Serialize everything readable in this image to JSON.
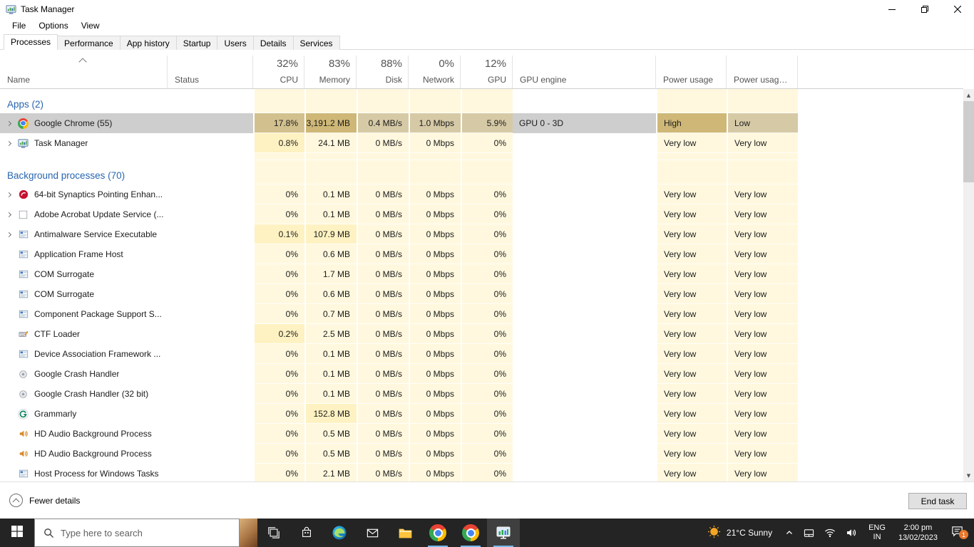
{
  "titlebar": {
    "title": "Task Manager"
  },
  "menubar": {
    "items": [
      "File",
      "Options",
      "View"
    ]
  },
  "tabs": {
    "items": [
      "Processes",
      "Performance",
      "App history",
      "Startup",
      "Users",
      "Details",
      "Services"
    ],
    "selected": "Processes"
  },
  "header": {
    "columns": [
      {
        "id": "name",
        "label": "Name",
        "pct": ""
      },
      {
        "id": "status",
        "label": "Status",
        "pct": ""
      },
      {
        "id": "cpu",
        "label": "CPU",
        "pct": "32%"
      },
      {
        "id": "memory",
        "label": "Memory",
        "pct": "83%"
      },
      {
        "id": "disk",
        "label": "Disk",
        "pct": "88%"
      },
      {
        "id": "network",
        "label": "Network",
        "pct": "0%"
      },
      {
        "id": "gpu",
        "label": "GPU",
        "pct": "12%"
      },
      {
        "id": "gpu_engine",
        "label": "GPU engine",
        "pct": ""
      },
      {
        "id": "power",
        "label": "Power usage",
        "pct": ""
      },
      {
        "id": "power_trend",
        "label": "Power usage t...",
        "pct": ""
      }
    ]
  },
  "groups": [
    {
      "label": "Apps (2)",
      "rows": [
        {
          "name": "Google Chrome (55)",
          "icon": "chrome-icon",
          "expand": true,
          "selected": true,
          "cpu": "17.8%",
          "memory": "3,191.2 MB",
          "disk": "0.4 MB/s",
          "network": "1.0 Mbps",
          "gpu": "5.9%",
          "gpu_engine": "GPU 0 - 3D",
          "power": "High",
          "power_trend": "Low"
        },
        {
          "name": "Task Manager",
          "icon": "task-manager-icon",
          "expand": true,
          "cpu": "0.8%",
          "memory": "24.1 MB",
          "disk": "0 MB/s",
          "network": "0 Mbps",
          "gpu": "0%",
          "gpu_engine": "",
          "power": "Very low",
          "power_trend": "Very low"
        }
      ]
    },
    {
      "label": "Background processes (70)",
      "rows": [
        {
          "name": "64-bit Synaptics Pointing Enhan...",
          "icon": "synaptics-icon",
          "expand": true,
          "cpu": "0%",
          "memory": "0.1 MB",
          "disk": "0 MB/s",
          "network": "0 Mbps",
          "gpu": "0%",
          "gpu_engine": "",
          "power": "Very low",
          "power_trend": "Very low"
        },
        {
          "name": "Adobe Acrobat Update Service (...",
          "icon": "adobe-icon",
          "expand": true,
          "cpu": "0%",
          "memory": "0.1 MB",
          "disk": "0 MB/s",
          "network": "0 Mbps",
          "gpu": "0%",
          "gpu_engine": "",
          "power": "Very low",
          "power_trend": "Very low"
        },
        {
          "name": "Antimalware Service Executable",
          "icon": "windows-app-icon",
          "expand": true,
          "cpu": "0.1%",
          "memory": "107.9 MB",
          "disk": "0 MB/s",
          "network": "0 Mbps",
          "gpu": "0%",
          "gpu_engine": "",
          "power": "Very low",
          "power_trend": "Very low"
        },
        {
          "name": "Application Frame Host",
          "icon": "windows-app-icon",
          "cpu": "0%",
          "memory": "0.6 MB",
          "disk": "0 MB/s",
          "network": "0 Mbps",
          "gpu": "0%",
          "gpu_engine": "",
          "power": "Very low",
          "power_trend": "Very low"
        },
        {
          "name": "COM Surrogate",
          "icon": "windows-app-icon",
          "cpu": "0%",
          "memory": "1.7 MB",
          "disk": "0 MB/s",
          "network": "0 Mbps",
          "gpu": "0%",
          "gpu_engine": "",
          "power": "Very low",
          "power_trend": "Very low"
        },
        {
          "name": "COM Surrogate",
          "icon": "windows-app-icon",
          "cpu": "0%",
          "memory": "0.6 MB",
          "disk": "0 MB/s",
          "network": "0 Mbps",
          "gpu": "0%",
          "gpu_engine": "",
          "power": "Very low",
          "power_trend": "Very low"
        },
        {
          "name": "Component Package Support S...",
          "icon": "windows-app-icon",
          "cpu": "0%",
          "memory": "0.7 MB",
          "disk": "0 MB/s",
          "network": "0 Mbps",
          "gpu": "0%",
          "gpu_engine": "",
          "power": "Very low",
          "power_trend": "Very low"
        },
        {
          "name": "CTF Loader",
          "icon": "ctf-icon",
          "cpu": "0.2%",
          "memory": "2.5 MB",
          "disk": "0 MB/s",
          "network": "0 Mbps",
          "gpu": "0%",
          "gpu_engine": "",
          "power": "Very low",
          "power_trend": "Very low"
        },
        {
          "name": "Device Association Framework ...",
          "icon": "windows-app-icon",
          "cpu": "0%",
          "memory": "0.1 MB",
          "disk": "0 MB/s",
          "network": "0 Mbps",
          "gpu": "0%",
          "gpu_engine": "",
          "power": "Very low",
          "power_trend": "Very low"
        },
        {
          "name": "Google Crash Handler",
          "icon": "crash-icon",
          "cpu": "0%",
          "memory": "0.1 MB",
          "disk": "0 MB/s",
          "network": "0 Mbps",
          "gpu": "0%",
          "gpu_engine": "",
          "power": "Very low",
          "power_trend": "Very low"
        },
        {
          "name": "Google Crash Handler (32 bit)",
          "icon": "crash-icon",
          "cpu": "0%",
          "memory": "0.1 MB",
          "disk": "0 MB/s",
          "network": "0 Mbps",
          "gpu": "0%",
          "gpu_engine": "",
          "power": "Very low",
          "power_trend": "Very low"
        },
        {
          "name": "Grammarly",
          "icon": "grammarly-icon",
          "cpu": "0%",
          "memory": "152.8 MB",
          "disk": "0 MB/s",
          "network": "0 Mbps",
          "gpu": "0%",
          "gpu_engine": "",
          "power": "Very low",
          "power_trend": "Very low"
        },
        {
          "name": "HD Audio Background Process",
          "icon": "audio-icon",
          "cpu": "0%",
          "memory": "0.5 MB",
          "disk": "0 MB/s",
          "network": "0 Mbps",
          "gpu": "0%",
          "gpu_engine": "",
          "power": "Very low",
          "power_trend": "Very low"
        },
        {
          "name": "HD Audio Background Process",
          "icon": "audio-icon",
          "cpu": "0%",
          "memory": "0.5 MB",
          "disk": "0 MB/s",
          "network": "0 Mbps",
          "gpu": "0%",
          "gpu_engine": "",
          "power": "Very low",
          "power_trend": "Very low"
        },
        {
          "name": "Host Process for Windows Tasks",
          "icon": "windows-app-icon",
          "cpu": "0%",
          "memory": "2.1 MB",
          "disk": "0 MB/s",
          "network": "0 Mbps",
          "gpu": "0%",
          "gpu_engine": "",
          "power": "Very low",
          "power_trend": "Very low"
        }
      ]
    }
  ],
  "footer": {
    "details_toggle": "Fewer details",
    "end_task": "End task"
  },
  "taskbar": {
    "search_placeholder": "Type here to search",
    "apps": [
      {
        "icon": "task-view-icon"
      },
      {
        "icon": "microsoft-store-icon"
      },
      {
        "icon": "edge-icon"
      },
      {
        "icon": "mail-icon"
      },
      {
        "icon": "file-explorer-icon"
      },
      {
        "icon": "chrome-icon",
        "running": true
      },
      {
        "icon": "chrome-icon",
        "running": true
      },
      {
        "icon": "task-manager-icon",
        "running": true,
        "active": true
      }
    ],
    "tray": {
      "weather": "21°C Sunny",
      "icons": [
        "hidden-icons-chevron-icon",
        "touchpad-icon",
        "wifi-icon",
        "volume-icon"
      ],
      "lang_top": "ENG",
      "lang_bottom": "IN",
      "time": "2:00 pm",
      "date": "13/02/2023",
      "badge": "1"
    }
  },
  "colors": {
    "group_header_blue": "#2765af",
    "selection_gray": "#cecece",
    "heat_0": "#fff8de",
    "heat_1": "#fff2c2",
    "heat_2": "#ffe9a4",
    "heat_3": "#ffdf8c",
    "sel_heat_0": "#d8d1ba",
    "sel_heat_1": "#d6caa6",
    "sel_heat_2": "#d2c18e",
    "sel_heat_3": "#cfb877",
    "taskbar_bg": "#242424",
    "accent_underline": "#76b9ed",
    "badge_orange": "#e8762c"
  }
}
